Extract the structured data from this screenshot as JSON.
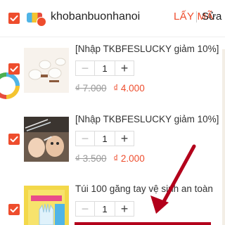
{
  "shop": {
    "name": "khobanbuonhanoi",
    "voucher_label": "LẤY MÃ",
    "edit_label": "Sửa"
  },
  "items": [
    {
      "title": "[Nhập TKBFESLUCKY giảm 10%] Miếng",
      "quantity": "1",
      "old_price": "₫ 7.000",
      "new_price": "₫ 4.000",
      "thumb_icon": "plastic-clips-image"
    },
    {
      "title": "[Nhập TKBFESLUCKY giảm 10%] Que",
      "quantity": "1",
      "old_price": "₫ 3.500",
      "new_price": "₫ 2.000",
      "thumb_icon": "baby-ear-pick-image"
    },
    {
      "title": "Túi 100 găng tay vệ sinh an toàn",
      "quantity": "1",
      "old_price": "",
      "new_price": "",
      "thumb_icon": "gloves-pack-image"
    }
  ],
  "stepper": {
    "minus": "−",
    "plus": "+"
  },
  "colors": {
    "accent": "#ee4d2d",
    "arrow": "#b3001b"
  }
}
